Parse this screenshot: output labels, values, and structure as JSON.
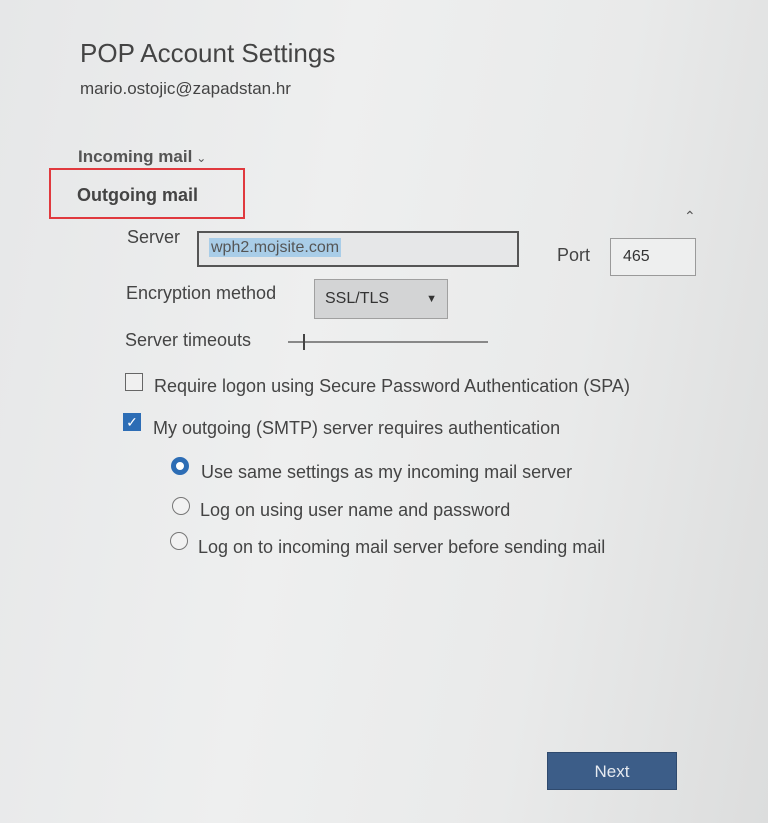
{
  "dialog": {
    "title": "POP Account Settings",
    "email": "mario.ostojic@zapadstan.hr"
  },
  "sections": {
    "incoming_label": "Incoming mail",
    "outgoing_label": "Outgoing mail"
  },
  "outgoing": {
    "server_label": "Server",
    "server_value": "wph2.mojsite.com",
    "port_label": "Port",
    "port_value": "465",
    "encryption_label": "Encryption method",
    "encryption_value": "SSL/TLS",
    "timeouts_label": "Server timeouts",
    "spa_label": "Require logon using Secure Password Authentication (SPA)",
    "spa_checked": false,
    "smtp_auth_label": "My outgoing (SMTP) server requires authentication",
    "smtp_auth_checked": true,
    "auth_options": [
      {
        "label": "Use same settings as my incoming mail server",
        "selected": true
      },
      {
        "label": "Log on using user name and password",
        "selected": false
      },
      {
        "label": "Log on to incoming mail server before sending mail",
        "selected": false
      }
    ]
  },
  "footer": {
    "next_label": "Next"
  },
  "colors": {
    "accent": "#2d6db5",
    "highlight_box": "#e0393e",
    "next_button": "#3c5d88",
    "selection": "#a9cde8"
  },
  "icons": [
    "chevron-down-icon",
    "chevron-up-icon",
    "dropdown-arrow-icon",
    "checkmark-icon"
  ]
}
